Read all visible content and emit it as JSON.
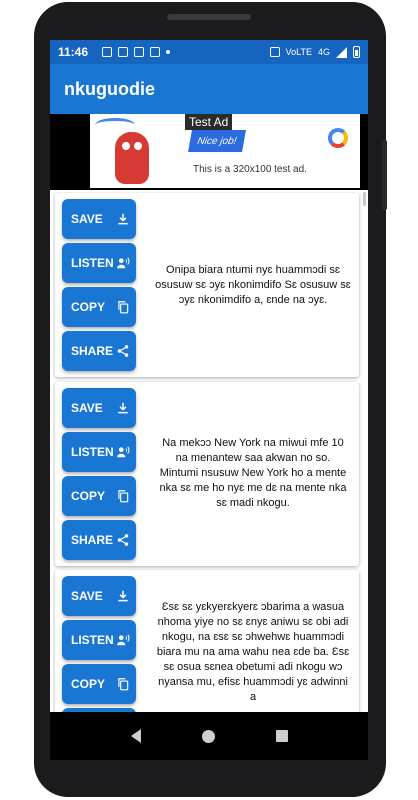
{
  "status_bar": {
    "time": "11:46",
    "network_label": "VoLTE",
    "cell_label": "4G",
    "icons": [
      "s-icon",
      "sim-icon",
      "check-icon",
      "gmail-icon",
      "dot-icon",
      "vibrate-icon",
      "signal-icon",
      "battery-icon"
    ]
  },
  "app_bar": {
    "title": "nkuguodie"
  },
  "ad": {
    "label": "Test Ad",
    "bubble_text": "Nice job!",
    "caption": "This is a 320x100 test ad."
  },
  "buttons": {
    "save": "SAVE",
    "listen": "LISTEN",
    "copy": "COPY",
    "share": "SHARE"
  },
  "cards": [
    {
      "text": "Onipa biara ntumi nyɛ huammɔdi sɛ osusuw sɛ ɔyɛ nkonimdifo Sɛ osusuw sɛ ɔyɛ nkonimdifo a, ɛnde na ɔyɛ."
    },
    {
      "text": "Na mekɔɔ New York na miwui mfe 10 na menantew saa akwan no so. Mintumi nsusuw New York ho a mente nka sɛ me ho nyɛ me dɛ na mente nka sɛ madi nkogu."
    },
    {
      "text": "Ɛsɛ sɛ yɛkyerɛkyerɛ ɔbarima a wasua nhoma yiye no sɛ ɛnyɛ aniwu sɛ obi adi nkogu, na ɛsɛ sɛ ɔhwehwɛ huammɔdi biara mu na ama wahu nea ɛde ba. Ɛsɛ sɛ osua sɛnea obetumi adi nkogu wɔ nyansa mu, efisɛ huammɔdi yɛ adwinni a"
    }
  ],
  "colors": {
    "primary": "#1976d2",
    "status": "#1565c0"
  }
}
